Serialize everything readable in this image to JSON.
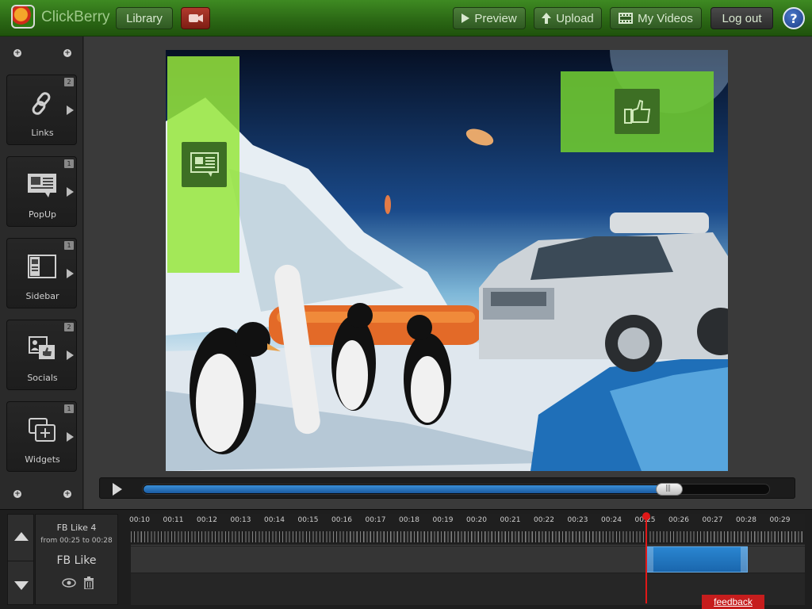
{
  "app": {
    "brand": "ClickBerry"
  },
  "toolbar": {
    "library": "Library",
    "preview": "Preview",
    "upload": "Upload",
    "my_videos": "My Videos",
    "logout": "Log out",
    "help": "?"
  },
  "sidebar": {
    "tools": [
      {
        "label": "Links",
        "count": "2",
        "icon": "link-icon"
      },
      {
        "label": "PopUp",
        "count": "1",
        "icon": "popup-icon"
      },
      {
        "label": "Sidebar",
        "count": "1",
        "icon": "sidebar-icon"
      },
      {
        "label": "Socials",
        "count": "2",
        "icon": "socials-icon"
      },
      {
        "label": "Widgets",
        "count": "1",
        "icon": "widgets-icon"
      }
    ]
  },
  "player": {
    "progress": 0.84
  },
  "timeline": {
    "selected": {
      "name": "FB Like 4",
      "range": "from 00:25 to 00:28",
      "type": "FB Like"
    },
    "ticks": [
      "00:10",
      "00:11",
      "00:12",
      "00:13",
      "00:14",
      "00:15",
      "00:16",
      "00:17",
      "00:18",
      "00:19",
      "00:20",
      "00:21",
      "00:22",
      "00:23",
      "00:24",
      "00:25",
      "00:26",
      "00:27",
      "00:28",
      "00:29"
    ]
  },
  "footer": {
    "feedback": "feedback"
  },
  "colors": {
    "brand_green": "#2a6614",
    "overlay_green": "#96e63c",
    "clip_blue": "#1a66ad",
    "playhead_red": "#e01818"
  }
}
